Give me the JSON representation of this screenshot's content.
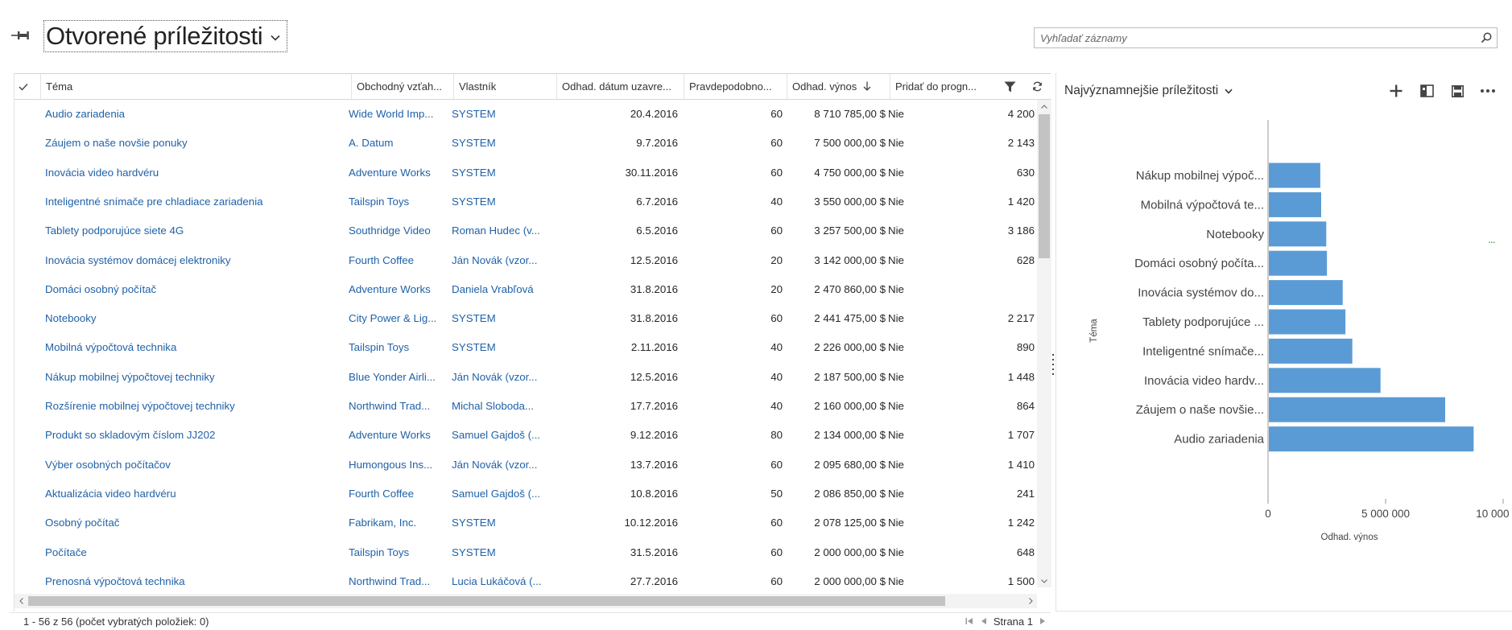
{
  "page": {
    "title": "Otvorené príležitosti",
    "search_placeholder": "Vyhľadať záznamy"
  },
  "columns": [
    {
      "label": "Téma"
    },
    {
      "label": "Obchodný vzťah..."
    },
    {
      "label": "Vlastník"
    },
    {
      "label": "Odhad. dátum uzavre..."
    },
    {
      "label": "Pravdepodobno..."
    },
    {
      "label": "Odhad. výnos"
    },
    {
      "label": "Pridať do progn..."
    }
  ],
  "rows": [
    {
      "topic": "Audio zariadenia",
      "account": "Wide World Imp...",
      "owner": "SYSTEM",
      "date": "20.4.2016",
      "prob": "60",
      "revenue": "8 710 785,00 $",
      "forecast": "Nie",
      "extra": "4 200"
    },
    {
      "topic": "Záujem o naše novšie ponuky",
      "account": "A. Datum",
      "owner": "SYSTEM",
      "date": "9.7.2016",
      "prob": "60",
      "revenue": "7 500 000,00 $",
      "forecast": "Nie",
      "extra": "2 143"
    },
    {
      "topic": "Inovácia video hardvéru",
      "account": "Adventure Works",
      "owner": "SYSTEM",
      "date": "30.11.2016",
      "prob": "60",
      "revenue": "4 750 000,00 $",
      "forecast": "Nie",
      "extra": "630"
    },
    {
      "topic": "Inteligentné snímače pre chladiace zariadenia",
      "account": "Tailspin Toys",
      "owner": "SYSTEM",
      "date": "6.7.2016",
      "prob": "40",
      "revenue": "3 550 000,00 $",
      "forecast": "Nie",
      "extra": "1 420"
    },
    {
      "topic": "Tablety podporujúce siete 4G",
      "account": "Southridge Video",
      "owner": "Roman Hudec (v...",
      "date": "6.5.2016",
      "prob": "60",
      "revenue": "3 257 500,00 $",
      "forecast": "Nie",
      "extra": "3 186"
    },
    {
      "topic": "Inovácia systémov domácej elektroniky",
      "account": "Fourth Coffee",
      "owner": "Ján Novák (vzor...",
      "date": "12.5.2016",
      "prob": "20",
      "revenue": "3 142 000,00 $",
      "forecast": "Nie",
      "extra": "628"
    },
    {
      "topic": "Domáci osobný počítač",
      "account": "Adventure Works",
      "owner": "Daniela Vrabľová",
      "date": "31.8.2016",
      "prob": "20",
      "revenue": "2 470 860,00 $",
      "forecast": "Nie",
      "extra": ""
    },
    {
      "topic": "Notebooky",
      "account": "City Power & Lig...",
      "owner": "SYSTEM",
      "date": "31.8.2016",
      "prob": "60",
      "revenue": "2 441 475,00 $",
      "forecast": "Nie",
      "extra": "2 217"
    },
    {
      "topic": "Mobilná výpočtová technika",
      "account": "Tailspin Toys",
      "owner": "SYSTEM",
      "date": "2.11.2016",
      "prob": "40",
      "revenue": "2 226 000,00 $",
      "forecast": "Nie",
      "extra": "890"
    },
    {
      "topic": "Nákup mobilnej výpočtovej techniky",
      "account": "Blue Yonder Airli...",
      "owner": "Ján Novák (vzor...",
      "date": "12.5.2016",
      "prob": "40",
      "revenue": "2 187 500,00 $",
      "forecast": "Nie",
      "extra": "1 448"
    },
    {
      "topic": "Rozšírenie mobilnej výpočtovej techniky",
      "account": "Northwind Trad...",
      "owner": "Michal Sloboda...",
      "date": "17.7.2016",
      "prob": "40",
      "revenue": "2 160 000,00 $",
      "forecast": "Nie",
      "extra": "864"
    },
    {
      "topic": "Produkt so skladovým číslom JJ202",
      "account": "Adventure Works",
      "owner": "Samuel Gajdoš (...",
      "date": "9.12.2016",
      "prob": "80",
      "revenue": "2 134 000,00 $",
      "forecast": "Nie",
      "extra": "1 707"
    },
    {
      "topic": "Výber osobných počítačov",
      "account": "Humongous Ins...",
      "owner": "Ján Novák (vzor...",
      "date": "13.7.2016",
      "prob": "60",
      "revenue": "2 095 680,00 $",
      "forecast": "Nie",
      "extra": "1 410"
    },
    {
      "topic": "Aktualizácia video hardvéru",
      "account": "Fourth Coffee",
      "owner": "Samuel Gajdoš (...",
      "date": "10.8.2016",
      "prob": "50",
      "revenue": "2 086 850,00 $",
      "forecast": "Nie",
      "extra": "241"
    },
    {
      "topic": "Osobný počítač",
      "account": "Fabrikam, Inc.",
      "owner": "SYSTEM",
      "date": "10.12.2016",
      "prob": "60",
      "revenue": "2 078 125,00 $",
      "forecast": "Nie",
      "extra": "1 242"
    },
    {
      "topic": "Počítače",
      "account": "Tailspin Toys",
      "owner": "SYSTEM",
      "date": "31.5.2016",
      "prob": "60",
      "revenue": "2 000 000,00 $",
      "forecast": "Nie",
      "extra": "648"
    },
    {
      "topic": "Prenosná výpočtová technika",
      "account": "Northwind Trad...",
      "owner": "Lucia Lukáčová (...",
      "date": "27.7.2016",
      "prob": "60",
      "revenue": "2 000 000,00 $",
      "forecast": "Nie",
      "extra": "1 500"
    }
  ],
  "footer": {
    "count": "1 - 56  z 56  (počet vybratých položiek: 0)",
    "page_label": "Strana 1"
  },
  "pane": {
    "title": "Najvýznamnejšie príležitosti",
    "dots": "..."
  },
  "chart_data": {
    "type": "bar",
    "orientation": "horizontal",
    "categories": [
      "Nákup mobilnej výpoč...",
      "Mobilná výpočtová te...",
      "Notebooky",
      "Domáci osobný počíta...",
      "Inovácia systémov do...",
      "Tablety podporujúce ...",
      "Inteligentné snímače...",
      "Inovácia video hardv...",
      "Záujem o naše novšie...",
      "Audio zariadenia"
    ],
    "values": [
      2187500,
      2226000,
      2441475,
      2470860,
      3142000,
      3257500,
      3550000,
      4750000,
      7500000,
      8710785
    ],
    "xlabel": "Odhad. výnos",
    "ylabel": "Téma",
    "xlim": [
      0,
      10000000
    ],
    "ticks": [
      {
        "value": 0,
        "label": "0"
      },
      {
        "value": 5000000,
        "label": "5 000 000"
      },
      {
        "value": 10000000,
        "label": "10 000 000"
      }
    ],
    "bar_color": "#5b9bd5"
  }
}
